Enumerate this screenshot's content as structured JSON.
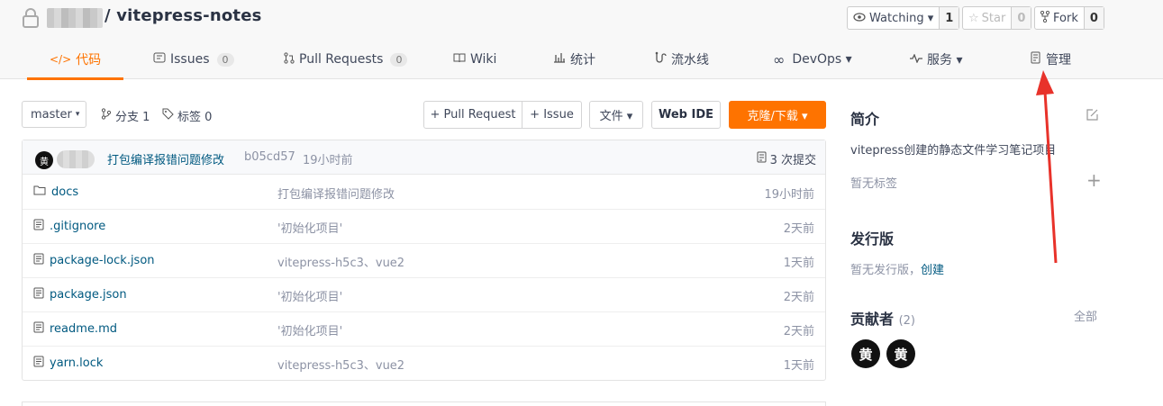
{
  "header": {
    "repo_name": "/ vitepress-notes",
    "watching": {
      "label": "Watching ▾",
      "count": "1"
    },
    "star": {
      "label": "Star",
      "count": "0"
    },
    "fork": {
      "label": "Fork",
      "count": "0"
    }
  },
  "tabs": [
    {
      "label": "代码",
      "icon": "code-icon",
      "active": true
    },
    {
      "label": "Issues",
      "count": "0",
      "icon": "issue-icon"
    },
    {
      "label": "Pull Requests",
      "count": "0",
      "icon": "pull-request-icon"
    },
    {
      "label": "Wiki",
      "icon": "book-icon"
    },
    {
      "label": "统计",
      "icon": "bar-chart-icon"
    },
    {
      "label": "流水线",
      "icon": "pipeline-icon"
    },
    {
      "label": "DevOps ▾",
      "icon": "infinity-icon"
    },
    {
      "label": "服务 ▾",
      "icon": "pulse-icon"
    },
    {
      "label": "管理",
      "icon": "settings-doc-icon"
    }
  ],
  "toolbar": {
    "branch": "master",
    "branches": "分支 1",
    "tags": "标签 0",
    "pull_request": "+ Pull Request",
    "issue": "+ Issue",
    "file": "文件 ▾",
    "web_ide": "Web IDE",
    "clone": "克隆/下载 ▾"
  },
  "commit": {
    "avatar_char": "黄",
    "message": "打包编译报错问题修改",
    "sha": "b05cd57",
    "time": "19小时前",
    "count": "3 次提交"
  },
  "files": [
    {
      "name": "docs",
      "type": "folder",
      "message": "打包编译报错问题修改",
      "time": "19小时前"
    },
    {
      "name": ".gitignore",
      "type": "file",
      "message": "'初始化项目'",
      "time": "2天前"
    },
    {
      "name": "package-lock.json",
      "type": "file",
      "message": "vitepress-h5c3、vue2",
      "time": "1天前"
    },
    {
      "name": "package.json",
      "type": "file",
      "message": "'初始化项目'",
      "time": "2天前"
    },
    {
      "name": "readme.md",
      "type": "file",
      "message": "'初始化项目'",
      "time": "2天前"
    },
    {
      "name": "yarn.lock",
      "type": "file",
      "message": "vitepress-h5c3、vue2",
      "time": "1天前"
    }
  ],
  "sidebar": {
    "intro_title": "简介",
    "description": "vitepress创建的静态文件学习笔记项目",
    "no_tags": "暂无标签",
    "release_title": "发行版",
    "no_release": "暂无发行版，",
    "create_link": "创建",
    "contributors_title": "贡献者",
    "contributors_count": "(2)",
    "all_link": "全部",
    "contributors": [
      "黄",
      "黄"
    ]
  },
  "colors": {
    "accent": "#fe7300",
    "link": "#005980",
    "annotation_arrow": "#e8322a"
  }
}
